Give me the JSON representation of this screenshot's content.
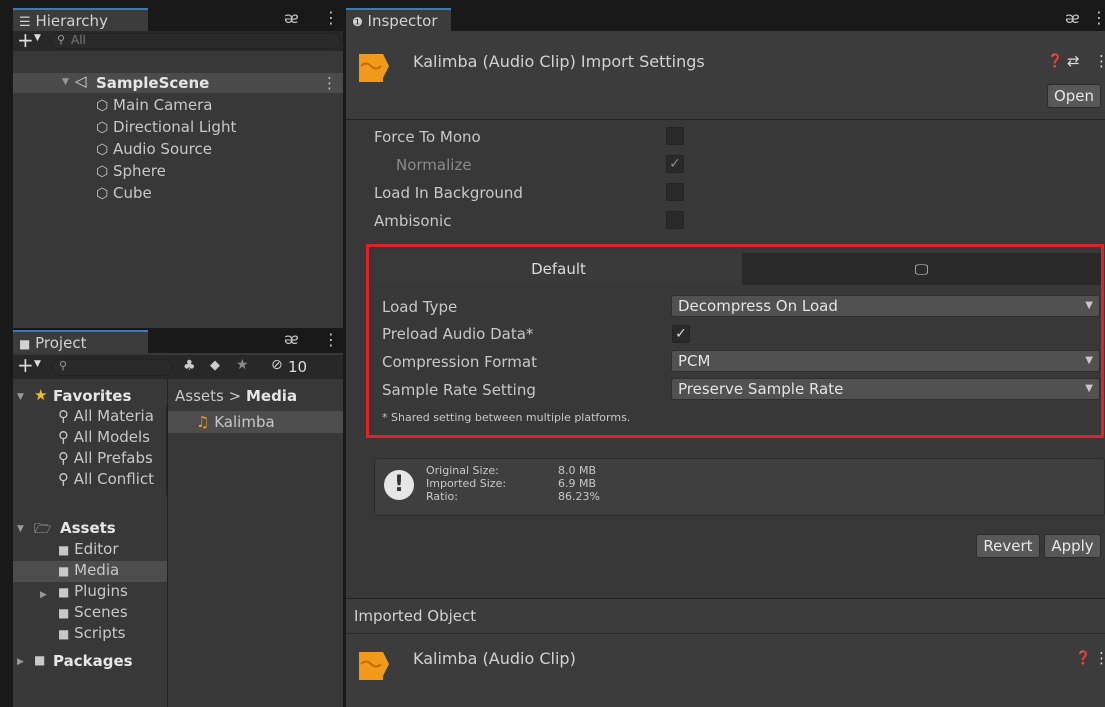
{
  "hierarchy": {
    "tab_label": "Hierarchy",
    "search_placeholder": "All",
    "scene_name": "SampleScene",
    "objects": [
      "Main Camera",
      "Directional Light",
      "Audio Source",
      "Sphere",
      "Cube"
    ]
  },
  "project": {
    "tab_label": "Project",
    "hidden_count": "10",
    "favorites_label": "Favorites",
    "favorites": [
      "All Materia",
      "All Models",
      "All Prefabs",
      "All Conflict"
    ],
    "assets_label": "Assets",
    "asset_folders": [
      "Editor",
      "Media",
      "Plugins",
      "Scenes",
      "Scripts"
    ],
    "packages_label": "Packages",
    "breadcrumb_root": "Assets",
    "breadcrumb_sep": ">",
    "breadcrumb_current": "Media",
    "files": [
      "Kalimba"
    ]
  },
  "inspector": {
    "tab_label": "Inspector",
    "title": "Kalimba (Audio Clip) Import Settings",
    "open_label": "Open",
    "options": [
      {
        "label": "Force To Mono",
        "checked": false
      },
      {
        "label": "Normalize",
        "checked": true
      },
      {
        "label": "Load In Background",
        "checked": false
      },
      {
        "label": "Ambisonic",
        "checked": false
      }
    ],
    "platform_tab_default": "Default",
    "settings": {
      "load_type_label": "Load Type",
      "load_type_value": "Decompress On Load",
      "preload_label": "Preload Audio Data*",
      "preload_checked": true,
      "compression_label": "Compression Format",
      "compression_value": "PCM",
      "sample_rate_label": "Sample Rate Setting",
      "sample_rate_value": "Preserve Sample Rate",
      "shared_note": "* Shared setting between multiple platforms."
    },
    "info": {
      "original_label": "Original Size:",
      "original_value": "8.0 MB",
      "imported_label": "Imported Size:",
      "imported_value": "6.9 MB",
      "ratio_label": "Ratio:",
      "ratio_value": "86.23%"
    },
    "revert_label": "Revert",
    "apply_label": "Apply",
    "imported_object_label": "Imported Object",
    "imported_object_title": "Kalimba (Audio Clip)"
  },
  "colors": {
    "highlight": "#e0202a",
    "audio_icon": "#f39a1c",
    "tab_accent": "#3a79bb"
  }
}
